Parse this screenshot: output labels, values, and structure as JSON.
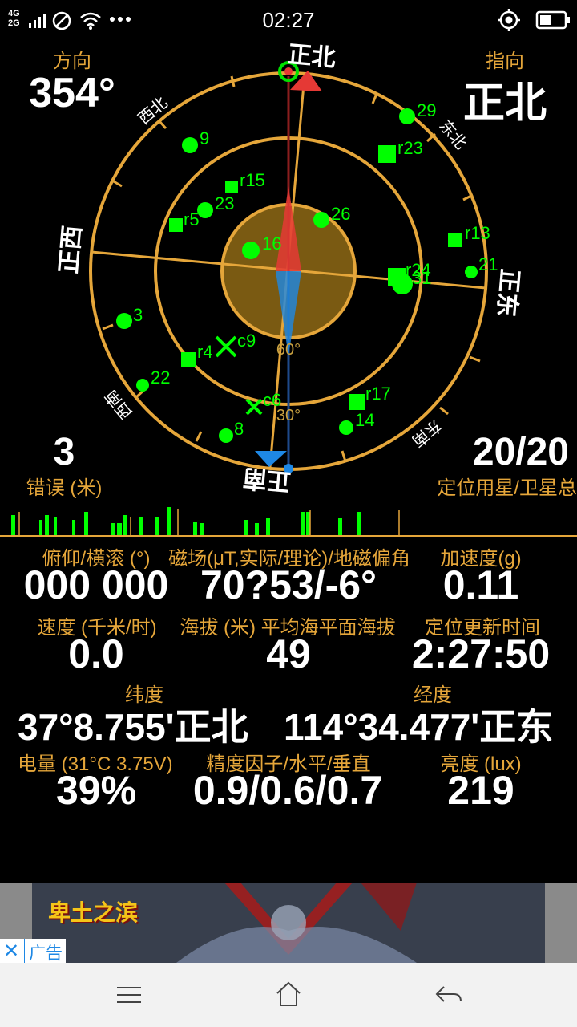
{
  "status_bar": {
    "network_top": "4G",
    "network_bottom": "2G",
    "time": "02:27",
    "icons": [
      "signal-icon",
      "do-not-disturb-icon",
      "wifi-icon",
      "more-icon",
      "location-icon",
      "battery-icon"
    ]
  },
  "compass": {
    "direction_label": "方向",
    "direction_value": "354°",
    "heading_label": "指向",
    "heading_value": "正北",
    "cardinal": {
      "north": "正北",
      "south": "正南",
      "east": "正东",
      "west": "正西"
    },
    "intercardinal": {
      "nw": "西北",
      "ne": "东北",
      "sw": "西南",
      "se": "东南"
    },
    "ring_labels": {
      "inner": "60°",
      "outer": "30°"
    },
    "satellites": [
      "29",
      "9",
      "r23",
      "r15",
      "23",
      "26",
      "r5",
      "16",
      "r13",
      "21",
      "r24",
      "31",
      "3",
      "c9",
      "r4",
      "22",
      "r17",
      "c6",
      "14",
      "8"
    ]
  },
  "error": {
    "value": "3",
    "label": "错误 (米)"
  },
  "sats_used": {
    "value": "20/20",
    "label": "定位用星/卫星总"
  },
  "stats": {
    "pitch_label": "俯仰/横滚 (°)",
    "pitch_value": "000 000",
    "mag_label": "磁场(μT,实际/理论)/地磁偏角",
    "mag_value": "70?53/-6°",
    "accel_label": "加速度(g)",
    "accel_value": "0.11",
    "speed_label": "速度 (千米/时)",
    "speed_value": "0.0",
    "alt_label": "海拔 (米) 平均海平面海拔",
    "alt_value": "49",
    "fix_label": "定位更新时间",
    "fix_value": "2:27:50",
    "lat_label": "纬度",
    "lat_value": "37°8.755'正北",
    "lon_label": "经度",
    "lon_value": "114°34.477'正东",
    "battery_label": "电量 (31°C 3.75V)",
    "battery_value": "39%",
    "dop_label": "精度因子/水平/垂直",
    "dop_value": "0.9/0.6/0.7",
    "lux_label": "亮度 (lux)",
    "lux_value": "219"
  },
  "ad": {
    "title": "卑土之滨",
    "tag": "广告",
    "close": "✕"
  },
  "colors": {
    "gold": "#e5a63a",
    "green": "#00ff00",
    "red": "#e53935",
    "blue": "#1e88e5"
  }
}
